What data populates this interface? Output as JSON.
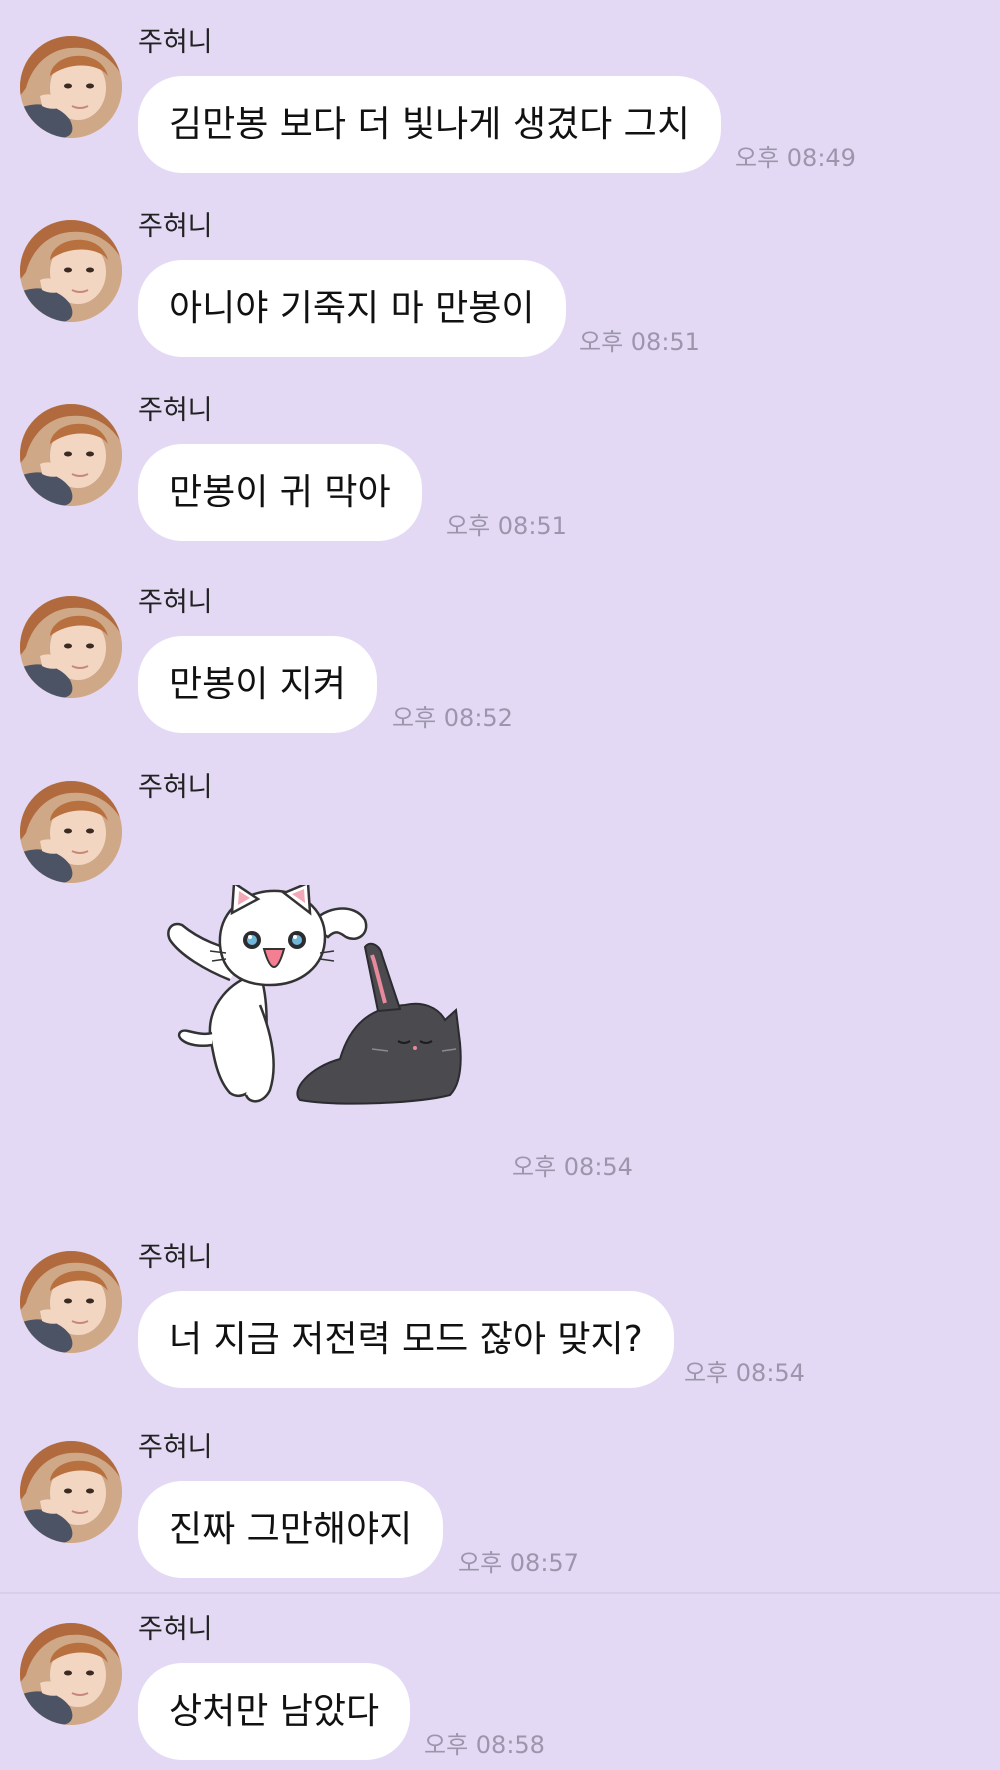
{
  "chat": {
    "messages": [
      {
        "sender": "주혀니",
        "text": "김만봉 보다 더 빛나게 생겼다 그치",
        "time": "오후 08:49"
      },
      {
        "sender": "주혀니",
        "text": "아니야 기죽지 마 만봉이",
        "time": "오후 08:51"
      },
      {
        "sender": "주혀니",
        "text": "만봉이 귀 막아",
        "time": "오후 08:51"
      },
      {
        "sender": "주혀니",
        "text": "만봉이 지켜",
        "time": "오후 08:52"
      },
      {
        "sender": "주혀니",
        "sticker": "white-cat-black-cat-sticker",
        "time": "오후 08:54"
      },
      {
        "sender": "주혀니",
        "text": "너 지금 저전력 모드 잖아 맞지?",
        "time": "오후 08:54"
      },
      {
        "sender": "주혀니",
        "text": "진짜 그만해야지",
        "time": "오후 08:57"
      },
      {
        "sender": "주혀니",
        "text": "상처만 남았다",
        "time": "오후 08:58"
      }
    ]
  },
  "colors": {
    "background": "#e3d9f5",
    "bubble": "#ffffff",
    "timestamp": "#9c95ab"
  },
  "icons": {
    "avatar": "profile-photo",
    "sticker": "white-cat-black-cat-sticker"
  }
}
